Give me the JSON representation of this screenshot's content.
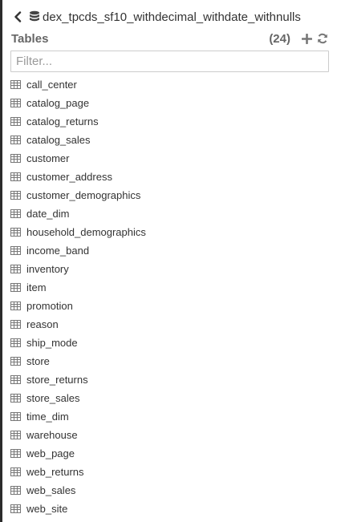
{
  "header": {
    "database_name": "dex_tpcds_sf10_withdecimal_withdate_withnulls",
    "back_icon": "chevron-left-icon",
    "database_icon": "database-icon"
  },
  "tables_section": {
    "title": "Tables",
    "count": "(24)",
    "add_icon": "plus-icon",
    "refresh_icon": "refresh-icon"
  },
  "filter": {
    "placeholder": "Filter...",
    "value": ""
  },
  "tables": [
    "call_center",
    "catalog_page",
    "catalog_returns",
    "catalog_sales",
    "customer",
    "customer_address",
    "customer_demographics",
    "date_dim",
    "household_demographics",
    "income_band",
    "inventory",
    "item",
    "promotion",
    "reason",
    "ship_mode",
    "store",
    "store_returns",
    "store_sales",
    "time_dim",
    "warehouse",
    "web_page",
    "web_returns",
    "web_sales",
    "web_site"
  ],
  "colors": {
    "sidebar_edge": "#2b2b2b",
    "muted_text": "#666666",
    "icon_gray": "#777777"
  }
}
